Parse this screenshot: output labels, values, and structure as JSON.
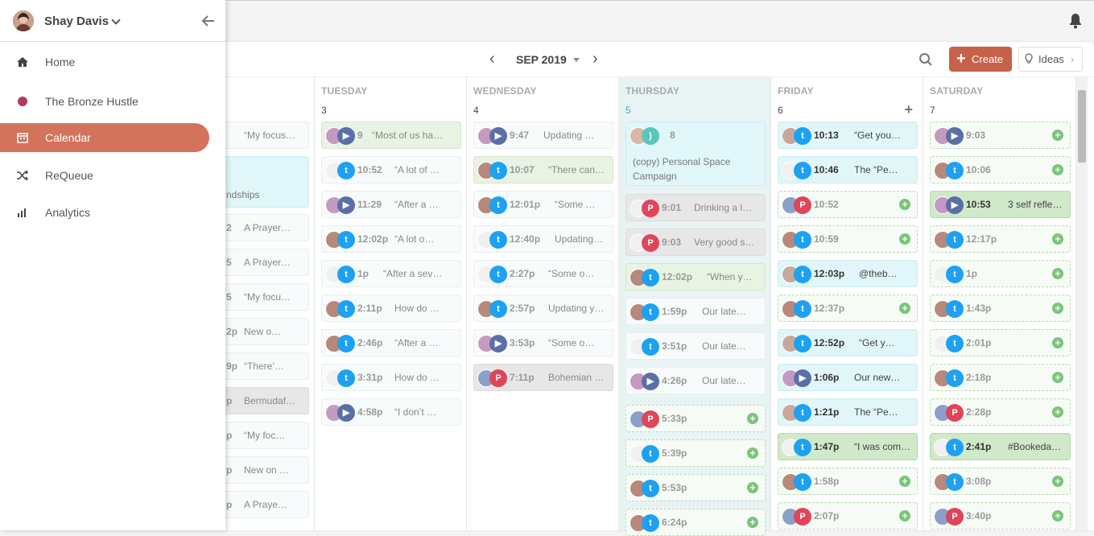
{
  "user": {
    "name": "Shay Davis"
  },
  "nav": [
    {
      "label": "Home",
      "icon": "home-icon"
    },
    {
      "label": "The Bronze Hustle",
      "icon": "dot-icon"
    },
    {
      "label": "Calendar",
      "icon": "calendar-icon",
      "active": true
    },
    {
      "label": "ReQueue",
      "icon": "shuffle-icon"
    },
    {
      "label": "Analytics",
      "icon": "bar-chart-icon"
    }
  ],
  "header": {
    "month": "SEP 2019",
    "create_label": "Create",
    "ideas_label": "Ideas"
  },
  "days": [
    {
      "name": "",
      "num": ""
    },
    {
      "name": "TUESDAY",
      "num": "3"
    },
    {
      "name": "WEDNESDAY",
      "num": "4"
    },
    {
      "name": "THURSDAY",
      "num": "5"
    },
    {
      "name": "FRIDAY",
      "num": "6"
    },
    {
      "name": "SATURDAY",
      "num": "7"
    }
  ],
  "monday": [
    {
      "t": "",
      "x": "“My focus…"
    },
    {
      "t": "",
      "x": "ndships",
      "big": true
    },
    {
      "t": "2",
      "x": "A Prayer…"
    },
    {
      "t": "5",
      "x": "A Prayer…"
    },
    {
      "t": "5",
      "x": "“My focu…"
    },
    {
      "t": "2p",
      "x": "New o…"
    },
    {
      "t": "9p",
      "x": "“There’…"
    },
    {
      "t": "p",
      "x": "Bermudaf…"
    },
    {
      "t": "p",
      "x": "“My foc…"
    },
    {
      "t": "p",
      "x": "New on …"
    },
    {
      "t": "p",
      "x": "A Praye…"
    }
  ],
  "tuesday": [
    {
      "t": "9",
      "x": "“Most of us ha…"
    },
    {
      "t": "10:52",
      "x": "“A lot of …"
    },
    {
      "t": "11:29",
      "x": "“After a …"
    },
    {
      "t": "12:02p",
      "x": "“A lot o…"
    },
    {
      "t": "1p",
      "x": "“After a sev…"
    },
    {
      "t": "2:11p",
      "x": "How do …"
    },
    {
      "t": "2:46p",
      "x": "“After a …"
    },
    {
      "t": "3:31p",
      "x": "How do …"
    },
    {
      "t": "4:58p",
      "x": "“I don’t …"
    }
  ],
  "wednesday": [
    {
      "t": "9:47",
      "x": "Updating …"
    },
    {
      "t": "10:07",
      "x": "“There can…"
    },
    {
      "t": "12:01p",
      "x": "“Some …"
    },
    {
      "t": "12:40p",
      "x": "Updating…"
    },
    {
      "t": "2:27p",
      "x": "“Some o…"
    },
    {
      "t": "2:57p",
      "x": "Updating y…"
    },
    {
      "t": "3:53p",
      "x": "“Some o…"
    },
    {
      "t": "7:11p",
      "x": "Bohemian …"
    }
  ],
  "thursday": {
    "big": {
      "t": "8",
      "x": "(copy) Personal Space Campaign"
    },
    "cards": [
      {
        "t": "9:01",
        "x": "Drinking a l…"
      },
      {
        "t": "9:03",
        "x": "Very good s…"
      },
      {
        "t": "12:02p",
        "x": "“When y…"
      },
      {
        "t": "1:59p",
        "x": "Our late…"
      },
      {
        "t": "3:51p",
        "x": "Our late…"
      },
      {
        "t": "4:26p",
        "x": "Our late…"
      },
      {
        "t": "5:33p",
        "x": ""
      },
      {
        "t": "5:39p",
        "x": ""
      },
      {
        "t": "5:53p",
        "x": ""
      },
      {
        "t": "6:24p",
        "x": ""
      }
    ]
  },
  "friday": [
    {
      "t": "10:13",
      "x": "“Get you…"
    },
    {
      "t": "10:46",
      "x": "The “Pe…"
    },
    {
      "t": "10:52",
      "x": ""
    },
    {
      "t": "10:59",
      "x": ""
    },
    {
      "t": "12:03p",
      "x": "@theb…"
    },
    {
      "t": "12:37p",
      "x": ""
    },
    {
      "t": "12:52p",
      "x": "“Get y…"
    },
    {
      "t": "1:06p",
      "x": "Our new…"
    },
    {
      "t": "1:21p",
      "x": "The “Pe…"
    },
    {
      "t": "1:47p",
      "x": "“I was com…"
    },
    {
      "t": "1:58p",
      "x": ""
    },
    {
      "t": "2:07p",
      "x": ""
    }
  ],
  "saturday": [
    {
      "t": "9:03",
      "x": ""
    },
    {
      "t": "10:06",
      "x": ""
    },
    {
      "t": "10:53",
      "x": "3 self reflec…"
    },
    {
      "t": "12:17p",
      "x": ""
    },
    {
      "t": "1p",
      "x": ""
    },
    {
      "t": "1:43p",
      "x": ""
    },
    {
      "t": "2:01p",
      "x": ""
    },
    {
      "t": "2:18p",
      "x": ""
    },
    {
      "t": "2:28p",
      "x": ""
    },
    {
      "t": "2:41p",
      "x": "#Bookedan…"
    },
    {
      "t": "3:08p",
      "x": ""
    },
    {
      "t": "3:40p",
      "x": ""
    }
  ],
  "colors": {
    "accent": "#d3735c",
    "create": "#c8614a",
    "today": "#e8f3f4",
    "twitter": "#1da1f2",
    "pinterest": "#e0455a",
    "facebook": "#5b6fa6"
  }
}
